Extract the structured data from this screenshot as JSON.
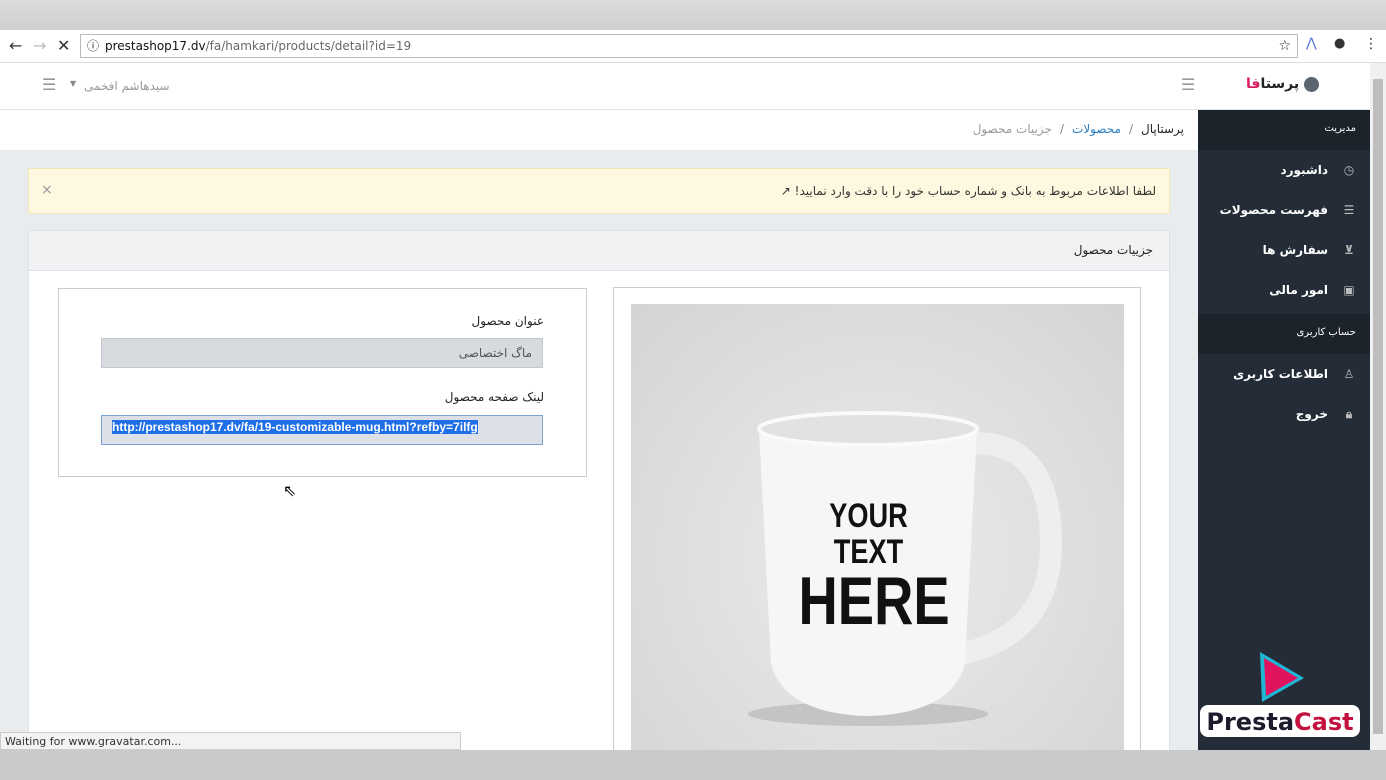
{
  "browser": {
    "url_host": "prestashop17.dv",
    "url_path": "/fa/hamkari/products/detail?id=19",
    "status": "Waiting for www.gravatar.com..."
  },
  "header": {
    "brand_a": "پرستا",
    "brand_b": "فا",
    "user": "سیدهاشم افخمی"
  },
  "breadcrumb": {
    "home": "پرستاپال",
    "products": "محصولات",
    "current": "جزییات محصول"
  },
  "sidebar": {
    "section1": "مدیریت",
    "items1": [
      {
        "label": "داشبورد",
        "icon": "dashboard-icon"
      },
      {
        "label": "فهرست محصولات",
        "icon": "list-icon"
      },
      {
        "label": "سفارش ها",
        "icon": "cart-icon"
      },
      {
        "label": "امور مالی",
        "icon": "calculator-icon"
      }
    ],
    "section2": "حساب کاربری",
    "items2": [
      {
        "label": "اطلاعات کاربری",
        "icon": "user-icon"
      },
      {
        "label": "خروج",
        "icon": "lock-icon"
      }
    ]
  },
  "alert": {
    "text": "لطفا اطلاعات مربوط به بانک و شماره حساب خود را با دقت وارد نمایید!",
    "close": "×"
  },
  "card": {
    "title": "جزییات محصول",
    "product_title_label": "عنوان محصول",
    "product_title_value": "ماگ اختصاصی",
    "link_label": "لینک صفحه محصول",
    "link_value": "http://prestashop17.dv/fa/19-customizable-mug.html?refby=7ilfg"
  },
  "image": {
    "line1": "YOUR TEXT",
    "line2": "HERE"
  },
  "watermark": "PrestaCast"
}
